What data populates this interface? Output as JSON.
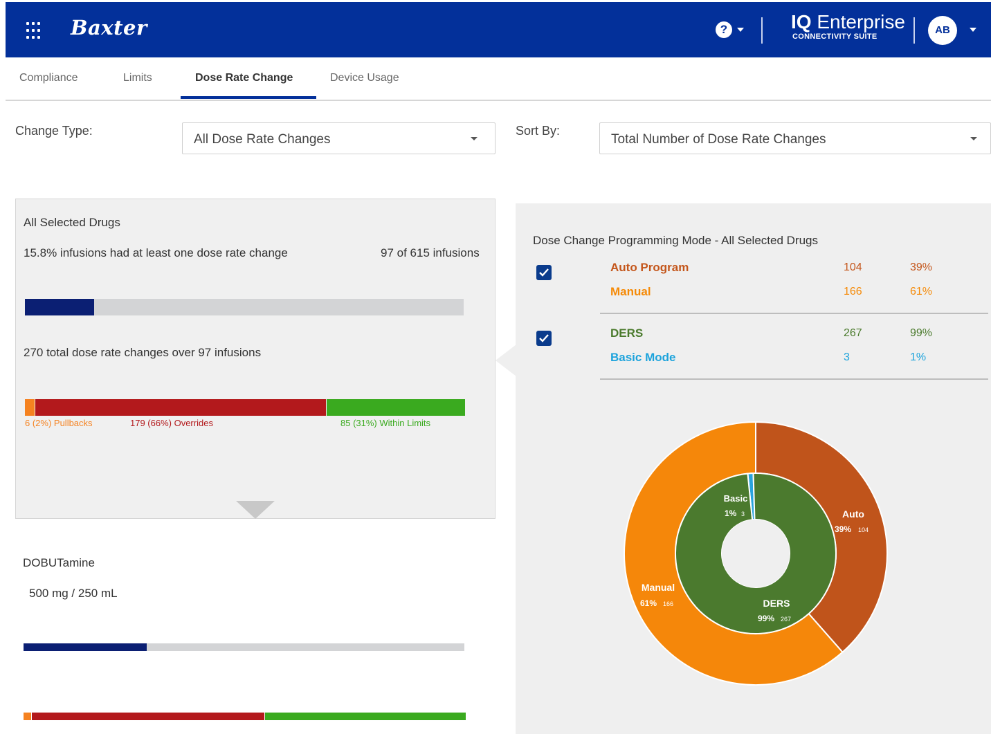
{
  "header": {
    "brand": "Baxter",
    "help_icon_glyph": "?",
    "product_bold": "IQ",
    "product_name": "Enterprise",
    "product_sub": "CONNECTIVITY SUITE",
    "avatar_initials": "AB",
    "bar_color": "#03309a"
  },
  "tabs": [
    {
      "label": "Compliance",
      "active": false
    },
    {
      "label": "Limits",
      "active": false
    },
    {
      "label": "Dose Rate Change",
      "active": true
    },
    {
      "label": "Device Usage",
      "active": false
    }
  ],
  "filters": {
    "change_type_label": "Change Type:",
    "change_type_value": "All Dose Rate Changes",
    "sort_by_label": "Sort By:",
    "sort_by_value": "Total Number of Dose Rate Changes"
  },
  "summary": {
    "title": "All Selected Drugs",
    "infusion_text": "15.8% infusions had at least one dose rate change",
    "infusion_count": "97 of 615 infusions",
    "infusion_fraction": 0.158,
    "changes_text": "270 total dose rate changes over 97 infusions",
    "breakdown": [
      {
        "label": "6 (2%) Pullbacks",
        "fraction": 0.022,
        "color": "#f58220"
      },
      {
        "label": "179 (66%) Overrides",
        "fraction": 0.663,
        "color": "#b3191c"
      },
      {
        "label": "85 (31%) Within Limits",
        "fraction": 0.315,
        "color": "#3aaa1f"
      }
    ]
  },
  "drug": {
    "name": "DOBUTamine",
    "concentration": "500 mg / 250 mL",
    "infusion_fraction": 0.28,
    "breakdown_fractions": [
      0.017,
      0.527,
      0.456
    ]
  },
  "mode_panel": {
    "title": "Dose Change Programming Mode - All Selected Drugs",
    "group1_checked": true,
    "group2_checked": true,
    "group1": [
      {
        "label": "Auto Program",
        "count": "104",
        "pct": "39%",
        "color": "#c4561b"
      },
      {
        "label": "Manual",
        "count": "166",
        "pct": "61%",
        "color": "#f58a07"
      }
    ],
    "group2": [
      {
        "label": "DERS",
        "count": "267",
        "pct": "99%",
        "color": "#4a7a2c"
      },
      {
        "label": "Basic Mode",
        "count": "3",
        "pct": "1%",
        "color": "#1ca3dc"
      }
    ]
  },
  "chart_data": {
    "type": "pie",
    "variant": "nested-donut",
    "rings": [
      {
        "name": "outer",
        "slices": [
          {
            "label": "Auto",
            "pct_label": "39%",
            "value_label": "104",
            "value": 104,
            "color": "#c0541b"
          },
          {
            "label": "Manual",
            "pct_label": "61%",
            "value_label": "166",
            "value": 166,
            "color": "#f5870a"
          }
        ]
      },
      {
        "name": "inner",
        "slices": [
          {
            "label": "Basic",
            "pct_label": "1%",
            "value_label": "3",
            "value": 3,
            "color": "#29a3dd"
          },
          {
            "label": "DERS",
            "pct_label": "99%",
            "value_label": "267",
            "value": 267,
            "color": "#4b7a2e"
          }
        ]
      }
    ]
  }
}
